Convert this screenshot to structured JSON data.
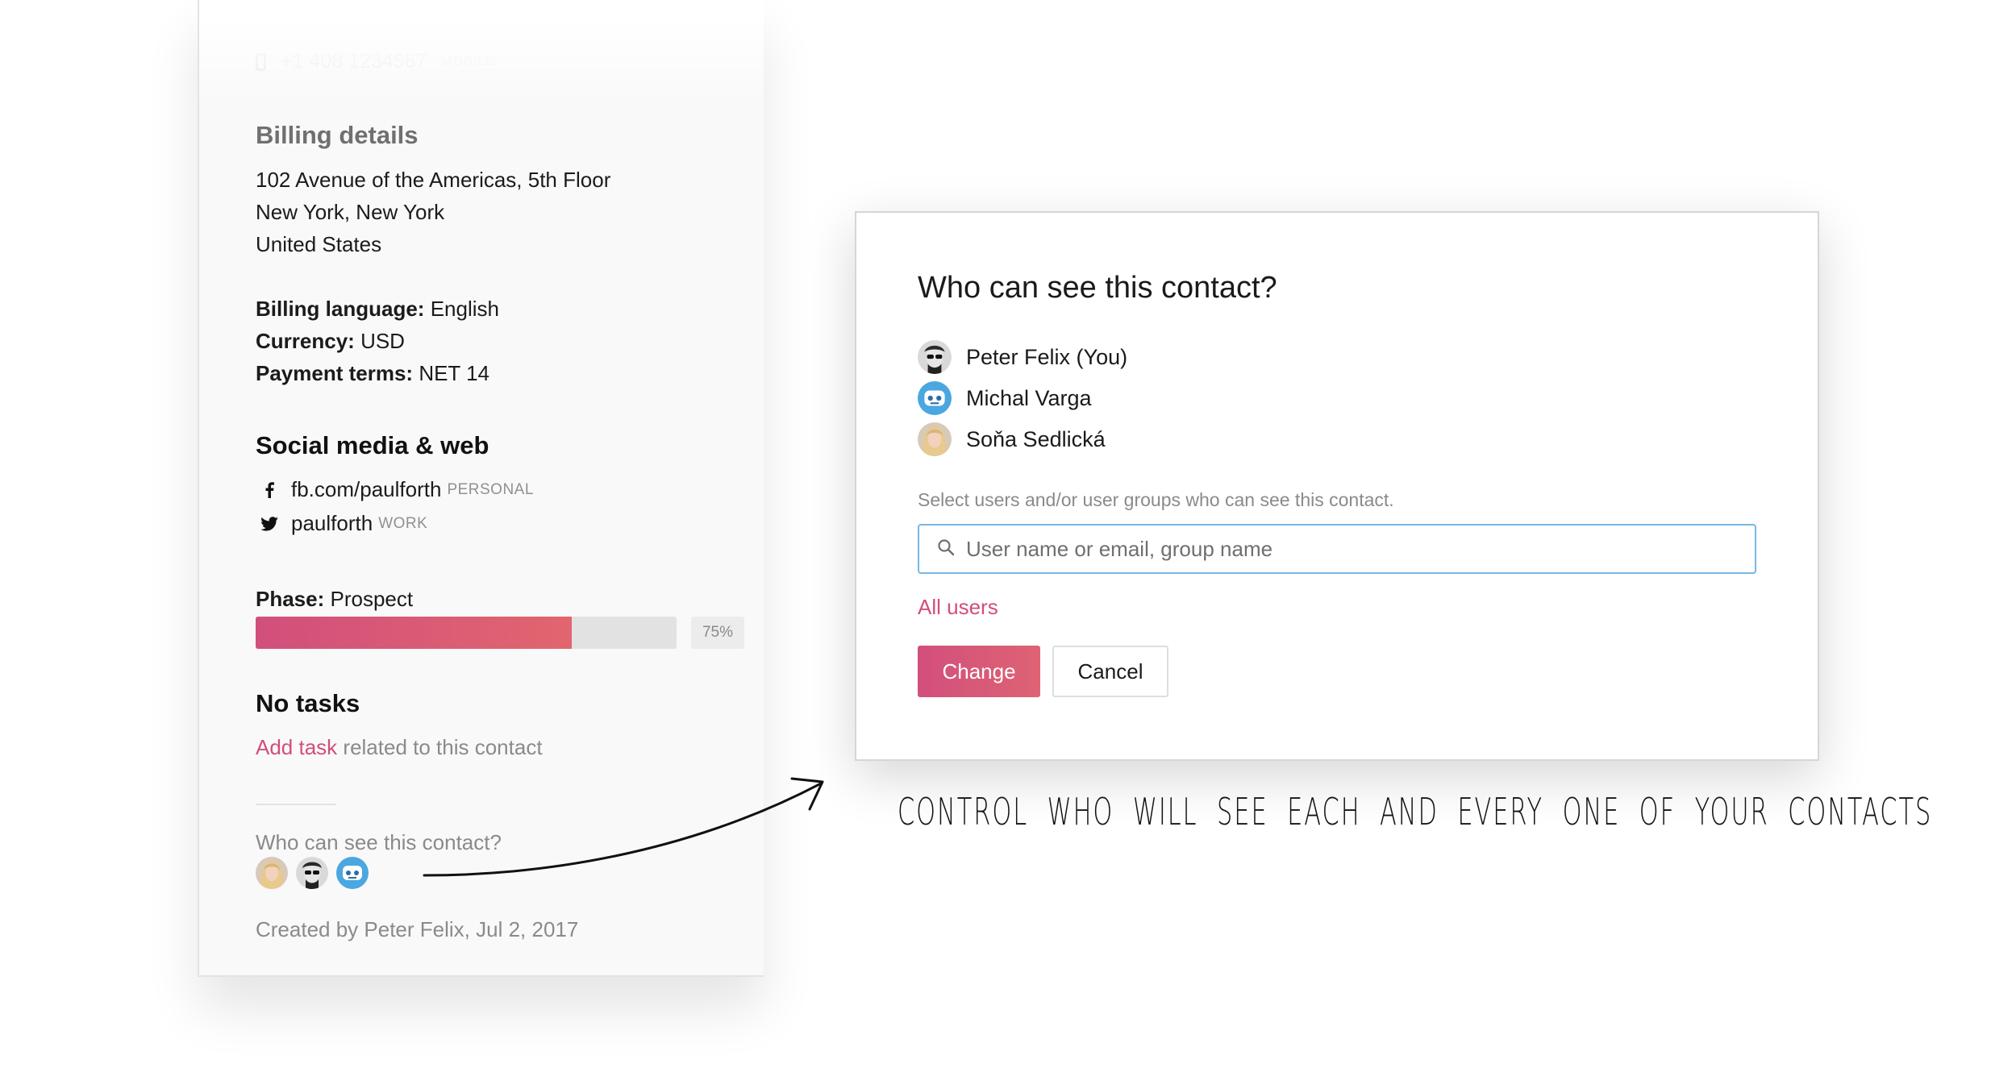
{
  "contact_card": {
    "phone": {
      "number": "+1 408 1234567",
      "type": "MOBILE"
    },
    "billing": {
      "title": "Billing details",
      "address_lines": [
        "102 Avenue of the Americas, 5th Floor",
        "New York, New York",
        "United States"
      ],
      "language_label": "Billing language:",
      "language_value": "English",
      "currency_label": "Currency:",
      "currency_value": "USD",
      "terms_label": "Payment terms:",
      "terms_value": "NET 14"
    },
    "social": {
      "title": "Social media & web",
      "items": [
        {
          "icon": "facebook-icon",
          "handle": "fb.com/paulforth",
          "tag": "PERSONAL"
        },
        {
          "icon": "twitter-icon",
          "handle": "paulforth",
          "tag": "WORK"
        }
      ]
    },
    "phase": {
      "label": "Phase:",
      "value": "Prospect",
      "progress": 0.75,
      "progress_label": "75%"
    },
    "tasks": {
      "title": "No tasks",
      "add_link": "Add task",
      "add_suffix": "related to this contact"
    },
    "visibility": {
      "label": "Who can see this contact?"
    },
    "created": "Created by Peter Felix, Jul 2, 2017"
  },
  "dialog": {
    "title": "Who can see this contact?",
    "users": [
      {
        "name": "Peter Felix (You)",
        "avatar": "man-sunglasses-avatar"
      },
      {
        "name": "Michal Varga",
        "avatar": "robot-avatar"
      },
      {
        "name": "Soňa Sedlická",
        "avatar": "blonde-woman-avatar"
      }
    ],
    "hint": "Select users and/or user groups who can see this contact.",
    "search": {
      "placeholder": "User name or email, group name",
      "value": ""
    },
    "all_users_link": "All users",
    "change_button": "Change",
    "cancel_button": "Cancel"
  },
  "caption": "CONTROL WHO WILL SEE EACH AND EVERY ONE OF YOUR CONTACTS",
  "colors": {
    "accent": "#d34d7d",
    "progress_start": "#d24f7c",
    "progress_end": "#e2656f",
    "search_border": "#76b8e6"
  }
}
